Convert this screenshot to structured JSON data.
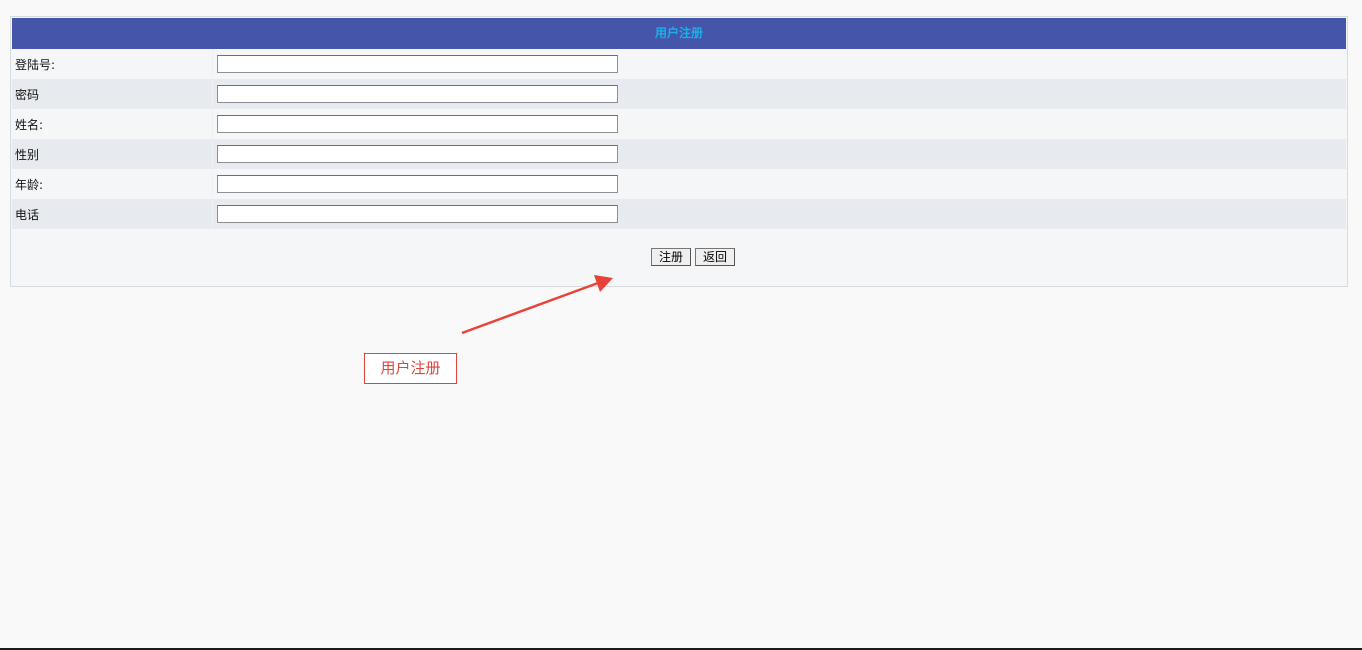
{
  "form": {
    "title": "用户注册",
    "fields": [
      {
        "label": "登陆号:",
        "value": ""
      },
      {
        "label": "密码",
        "value": ""
      },
      {
        "label": "姓名:",
        "value": ""
      },
      {
        "label": "性别",
        "value": ""
      },
      {
        "label": "年龄:",
        "value": ""
      },
      {
        "label": "电话",
        "value": ""
      }
    ],
    "register_label": "注册",
    "back_label": "返回"
  },
  "annotation": {
    "text": "用户注册",
    "color": "#e0443b"
  },
  "colors": {
    "header_bg": "#4556aa",
    "header_text": "#1ab0e8",
    "row_odd": "#f5f6f8",
    "row_even": "#e7eaef"
  }
}
